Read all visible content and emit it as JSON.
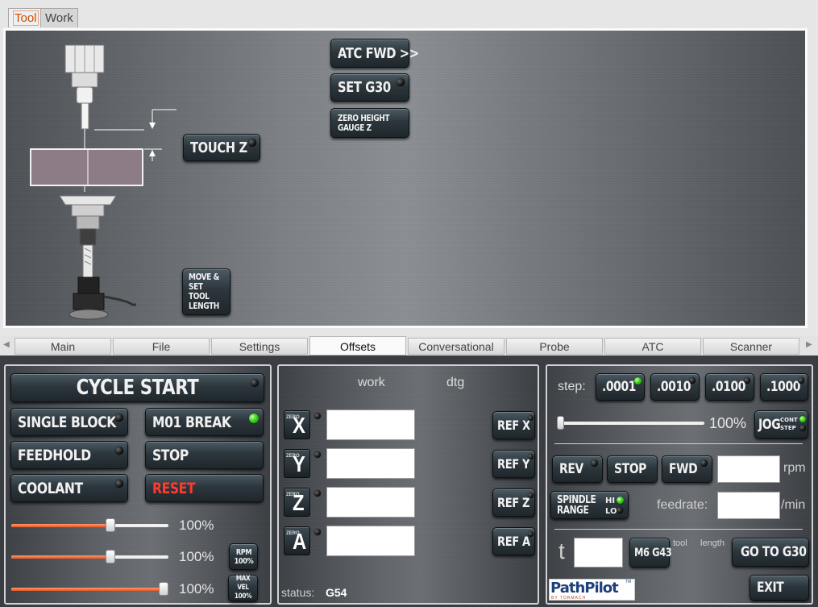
{
  "top_tabs": [
    {
      "label": "Tool",
      "active": true
    },
    {
      "label": "Work",
      "active": false
    }
  ],
  "tool_panel": {
    "touch_z": "TOUCH Z",
    "atc_fwd": "ATC FWD >>",
    "set_g30": "SET G30",
    "zero_height_gauge_line1": "ZERO HEIGHT",
    "zero_height_gauge_line2": "GAUGE Z",
    "move_set_tool_line1": "MOVE &",
    "move_set_tool_line2": "SET TOOL",
    "move_set_tool_line3": "LENGTH"
  },
  "notebook_tabs": [
    {
      "label": "Main",
      "active": false
    },
    {
      "label": "File",
      "active": false
    },
    {
      "label": "Settings",
      "active": false
    },
    {
      "label": "Offsets",
      "active": true
    },
    {
      "label": "Conversational",
      "active": false
    },
    {
      "label": "Probe",
      "active": false
    },
    {
      "label": "ATC",
      "active": false
    },
    {
      "label": "Scanner",
      "active": false
    }
  ],
  "left_panel": {
    "cycle_start": "CYCLE START",
    "single_block": "SINGLE BLOCK",
    "m01_break": "M01 BREAK",
    "feedhold": "FEEDHOLD",
    "stop": "STOP",
    "coolant": "COOLANT",
    "reset": "RESET",
    "reset_color": "#ff3b2f",
    "m01_led": "green",
    "sliders": [
      {
        "name": "feed-override",
        "percent_label": "100%",
        "value": 0.63
      },
      {
        "name": "spindle-override",
        "percent_label": "100%",
        "value": 0.63
      },
      {
        "name": "max-velocity",
        "percent_label": "100%",
        "value": 0.97
      }
    ],
    "rpm_btn_line1": "RPM",
    "rpm_btn_line2": "100%",
    "maxvel_btn_line1": "MAX VEL",
    "maxvel_btn_line2": "100%"
  },
  "dro_panel": {
    "col_work": "work",
    "col_dtg": "dtg",
    "zero_label": "ZERO",
    "axes": [
      {
        "axis": "X",
        "ref": "REF X",
        "value": ""
      },
      {
        "axis": "Y",
        "ref": "REF Y",
        "value": ""
      },
      {
        "axis": "Z",
        "ref": "REF Z",
        "value": ""
      },
      {
        "axis": "A",
        "ref": "REF A",
        "value": ""
      }
    ],
    "status_label": "status:",
    "status_value": "G54"
  },
  "right_panel": {
    "step_label": "step:",
    "steps": [
      {
        "label": ".0001",
        "active": true
      },
      {
        "label": ".0010",
        "active": false
      },
      {
        "label": ".0100",
        "active": false
      },
      {
        "label": ".1000",
        "active": false
      }
    ],
    "jog_percent": "100%",
    "jog_slider_value": 0.0,
    "jog_label": "JOG",
    "jog_cont": "CONT",
    "jog_step": "STEP",
    "rev": "REV",
    "spindle_stop": "STOP",
    "fwd": "FWD",
    "rpm_unit": "rpm",
    "rpm_value": "",
    "spindle_range_line1": "SPINDLE",
    "spindle_range_line2": "RANGE",
    "range_hi": "HI",
    "range_lo": "LO",
    "feedrate_label": "feedrate:",
    "feedrate_unit": "/min",
    "feedrate_value": "",
    "tool_label": "t",
    "tool_value": "",
    "m6g43": "M6 G43",
    "tool_small": "tool",
    "length_small": "length",
    "go_to_g30": "GO TO G30",
    "exit": "EXIT",
    "logo_text": "PathPilot",
    "logo_sub": "BY TORMACH",
    "logo_tm": "TM"
  },
  "colors": {
    "accent_orange": "#e2572a",
    "led_green": "#3ad41c",
    "button_dark": "#1f272c"
  }
}
